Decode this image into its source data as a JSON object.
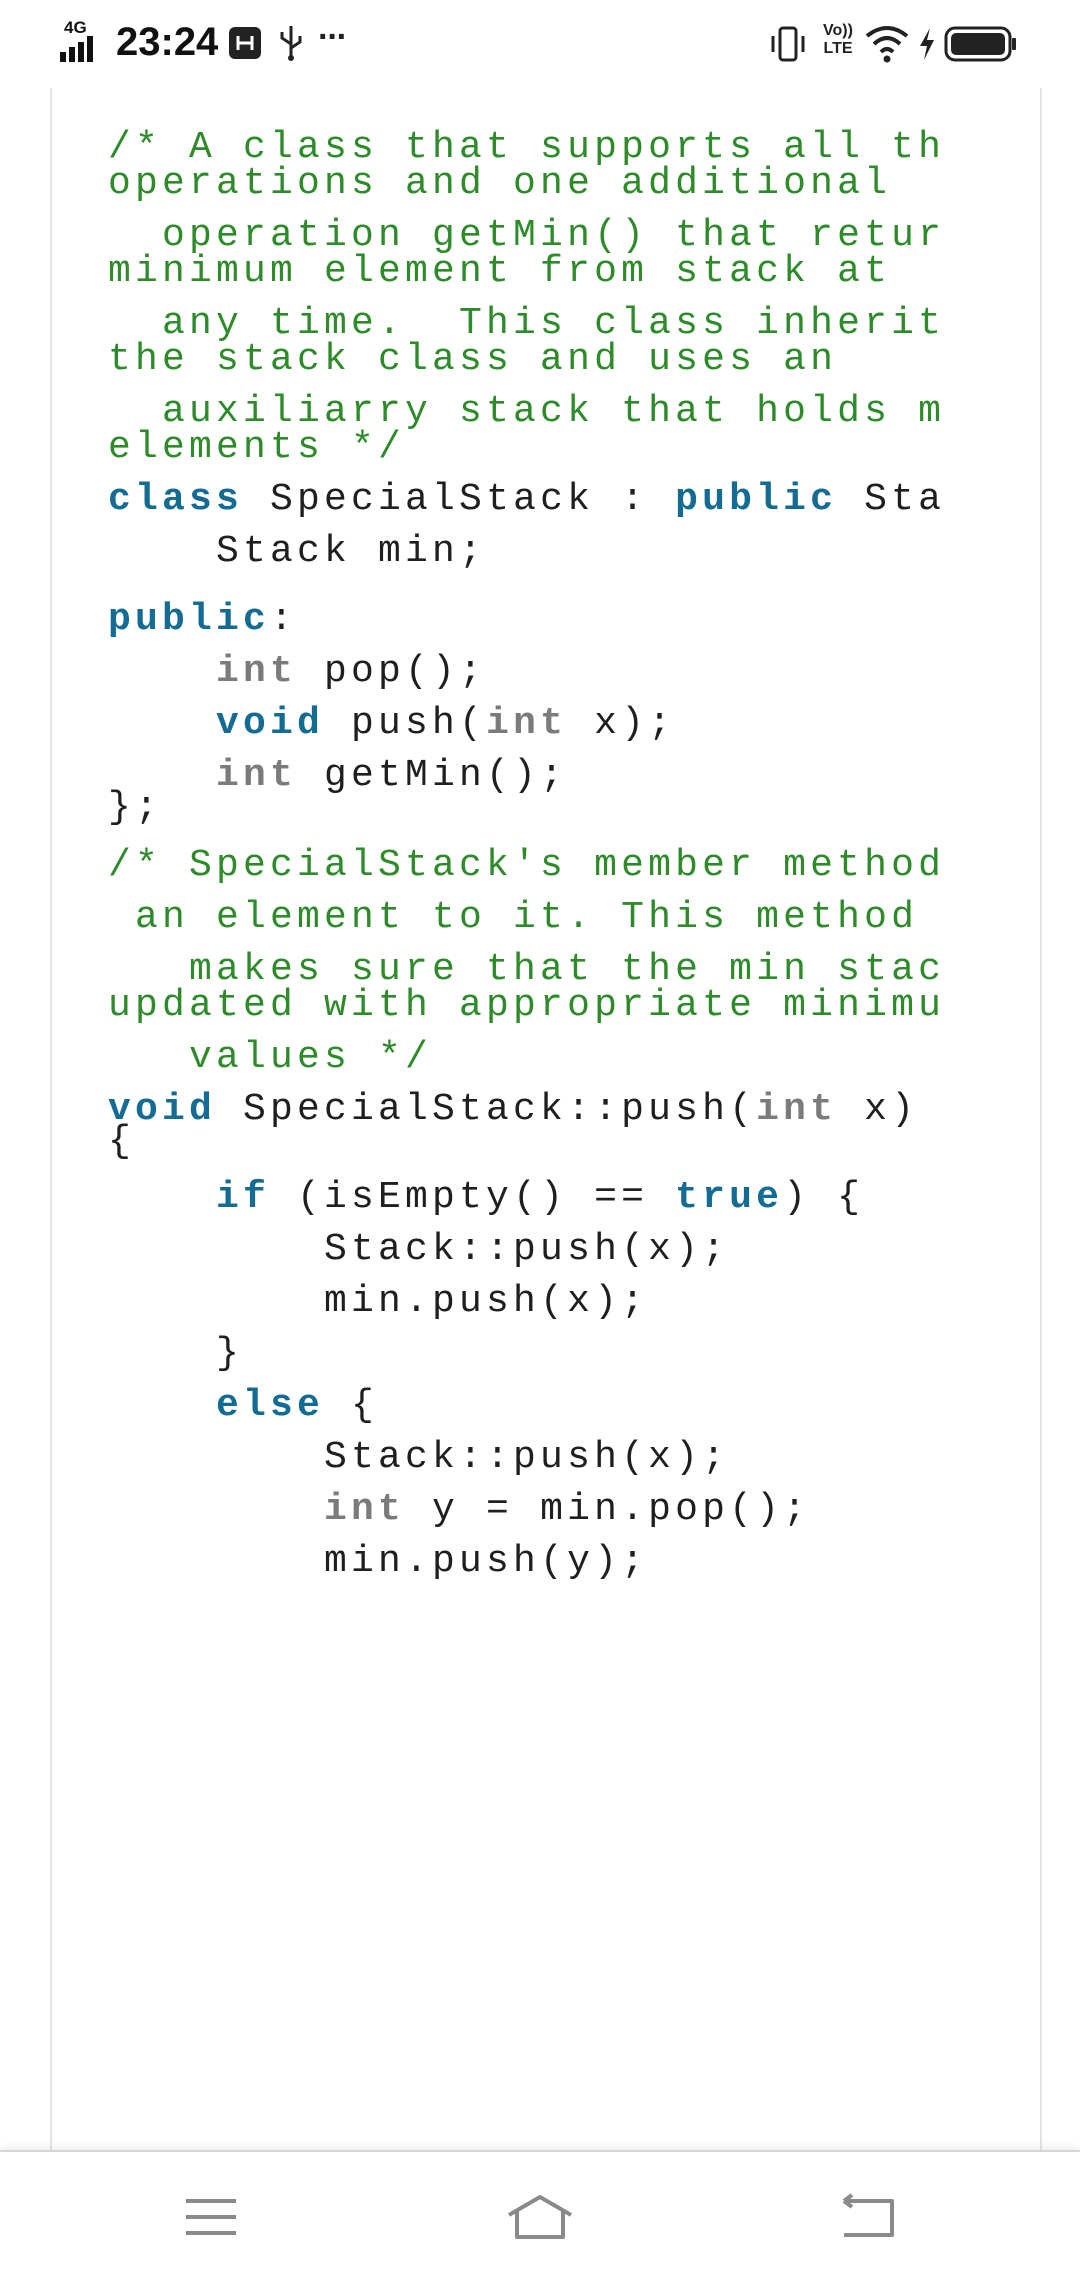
{
  "status_bar": {
    "network_type": "4G",
    "time": "23:24",
    "more_indicator": "···",
    "volte_label": "Vo)) LTE",
    "icons": [
      "signal-icon",
      "usb-debug-icon",
      "usb-icon",
      "vibrate-icon",
      "volte-icon",
      "wifi-icon",
      "charging-icon",
      "battery-icon"
    ]
  },
  "code": {
    "lines": [
      {
        "segments": [
          {
            "t": "/* A class that supports all th",
            "c": "cm"
          }
        ]
      },
      {
        "segments": [
          {
            "t": "operations and one additional",
            "c": "cm"
          }
        ]
      },
      {
        "segments": [
          {
            "t": "  operation getMin() that retur",
            "c": "cm"
          }
        ]
      },
      {
        "segments": [
          {
            "t": "minimum element from stack at",
            "c": "cm"
          }
        ]
      },
      {
        "segments": [
          {
            "t": "  any time.  This class inherit",
            "c": "cm"
          }
        ]
      },
      {
        "segments": [
          {
            "t": "the stack class and uses an",
            "c": "cm"
          }
        ]
      },
      {
        "segments": [
          {
            "t": "  auxiliarry stack that holds m",
            "c": "cm"
          }
        ]
      },
      {
        "segments": [
          {
            "t": "elements */",
            "c": "cm"
          }
        ]
      },
      {
        "segments": [
          {
            "t": "class",
            "c": "kw"
          },
          {
            "t": " SpecialStack : ",
            "c": "tx"
          },
          {
            "t": "public",
            "c": "kw"
          },
          {
            "t": " Sta",
            "c": "tx"
          }
        ]
      },
      {
        "segments": [
          {
            "t": "    Stack min;",
            "c": "tx"
          }
        ]
      },
      {
        "segments": [
          {
            "t": "public",
            "c": "kw"
          },
          {
            "t": ":",
            "c": "tx"
          }
        ]
      },
      {
        "segments": [
          {
            "t": "    ",
            "c": "tx"
          },
          {
            "t": "int",
            "c": "ty"
          },
          {
            "t": " pop();",
            "c": "tx"
          }
        ]
      },
      {
        "segments": [
          {
            "t": "    ",
            "c": "tx"
          },
          {
            "t": "void",
            "c": "kw"
          },
          {
            "t": " push(",
            "c": "tx"
          },
          {
            "t": "int",
            "c": "ty"
          },
          {
            "t": " x);",
            "c": "tx"
          }
        ]
      },
      {
        "segments": [
          {
            "t": "    ",
            "c": "tx"
          },
          {
            "t": "int",
            "c": "ty"
          },
          {
            "t": " getMin();",
            "c": "tx"
          }
        ]
      },
      {
        "segments": [
          {
            "t": "};",
            "c": "tx"
          }
        ]
      },
      {
        "segments": [
          {
            "t": "/* SpecialStack's member method",
            "c": "cm"
          }
        ]
      },
      {
        "segments": [
          {
            "t": " an element to it. This method",
            "c": "cm"
          }
        ]
      },
      {
        "segments": [
          {
            "t": "   makes sure that the min stac",
            "c": "cm"
          }
        ]
      },
      {
        "segments": [
          {
            "t": "updated with appropriate minimu",
            "c": "cm"
          }
        ]
      },
      {
        "segments": [
          {
            "t": "   values */",
            "c": "cm"
          }
        ]
      },
      {
        "segments": [
          {
            "t": "void",
            "c": "kw"
          },
          {
            "t": " SpecialStack::push(",
            "c": "tx"
          },
          {
            "t": "int",
            "c": "ty"
          },
          {
            "t": " x)",
            "c": "tx"
          }
        ]
      },
      {
        "segments": [
          {
            "t": "{",
            "c": "tx"
          }
        ]
      },
      {
        "segments": [
          {
            "t": "    ",
            "c": "tx"
          },
          {
            "t": "if",
            "c": "kw"
          },
          {
            "t": " (isEmpty() == ",
            "c": "tx"
          },
          {
            "t": "true",
            "c": "kw"
          },
          {
            "t": ") {",
            "c": "tx"
          }
        ]
      },
      {
        "segments": [
          {
            "t": "        Stack::push(x);",
            "c": "tx"
          }
        ]
      },
      {
        "segments": [
          {
            "t": "        min.push(x);",
            "c": "tx"
          }
        ]
      },
      {
        "segments": [
          {
            "t": "    }",
            "c": "tx"
          }
        ]
      },
      {
        "segments": [
          {
            "t": "    ",
            "c": "tx"
          },
          {
            "t": "else",
            "c": "kw"
          },
          {
            "t": " {",
            "c": "tx"
          }
        ]
      },
      {
        "segments": [
          {
            "t": "        Stack::push(x);",
            "c": "tx"
          }
        ]
      },
      {
        "segments": [
          {
            "t": "        ",
            "c": "tx"
          },
          {
            "t": "int",
            "c": "ty"
          },
          {
            "t": " y = min.pop();",
            "c": "tx"
          }
        ]
      },
      {
        "segments": [
          {
            "t": "        min.push(y);",
            "c": "tx"
          }
        ]
      }
    ]
  },
  "nav_bar": {
    "buttons": [
      "menu-icon",
      "home-icon",
      "back-icon"
    ]
  }
}
